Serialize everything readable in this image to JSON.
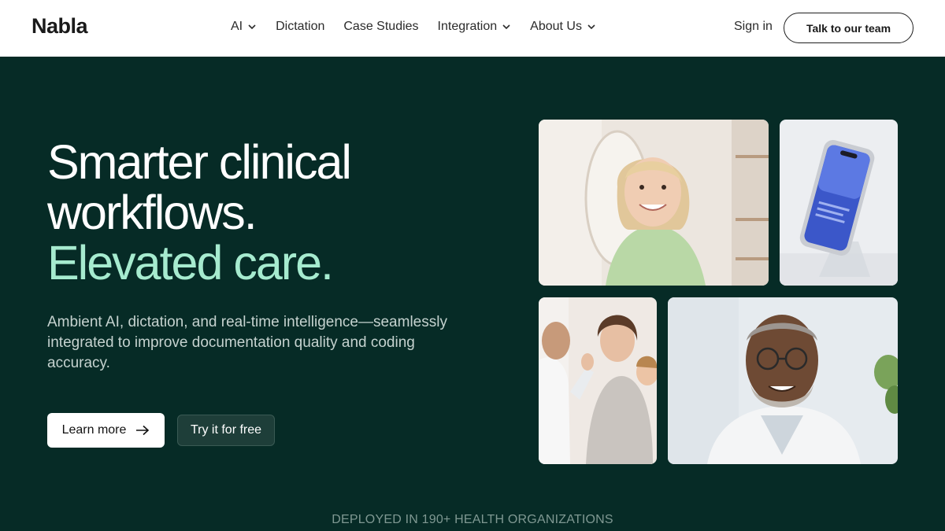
{
  "header": {
    "logo": "Nabla",
    "nav": [
      {
        "label": "AI",
        "dropdown": true
      },
      {
        "label": "Dictation",
        "dropdown": false
      },
      {
        "label": "Case Studies",
        "dropdown": false
      },
      {
        "label": "Integration",
        "dropdown": true
      },
      {
        "label": "About Us",
        "dropdown": true
      }
    ],
    "sign_in": "Sign in",
    "cta": "Talk to our team"
  },
  "hero": {
    "headline_line1": "Smarter clinical",
    "headline_line2": "workflows.",
    "headline_accent": "Elevated care.",
    "subtitle": "Ambient AI, dictation, and real-time intelligence—seamlessly integrated to improve documentation quality and coding accuracy.",
    "learn_more": "Learn more",
    "try_free": "Try it for free"
  },
  "footer_strip": {
    "deployed": "DEPLOYED IN 190+ HEALTH ORGANIZATIONS"
  },
  "colors": {
    "background": "#062b26",
    "accent": "#a6ebcf",
    "header_bg": "#ffffff"
  },
  "icons": {
    "nav_dropdown": "chevron-down-icon",
    "learn_more_arrow": "arrow-right-icon"
  }
}
